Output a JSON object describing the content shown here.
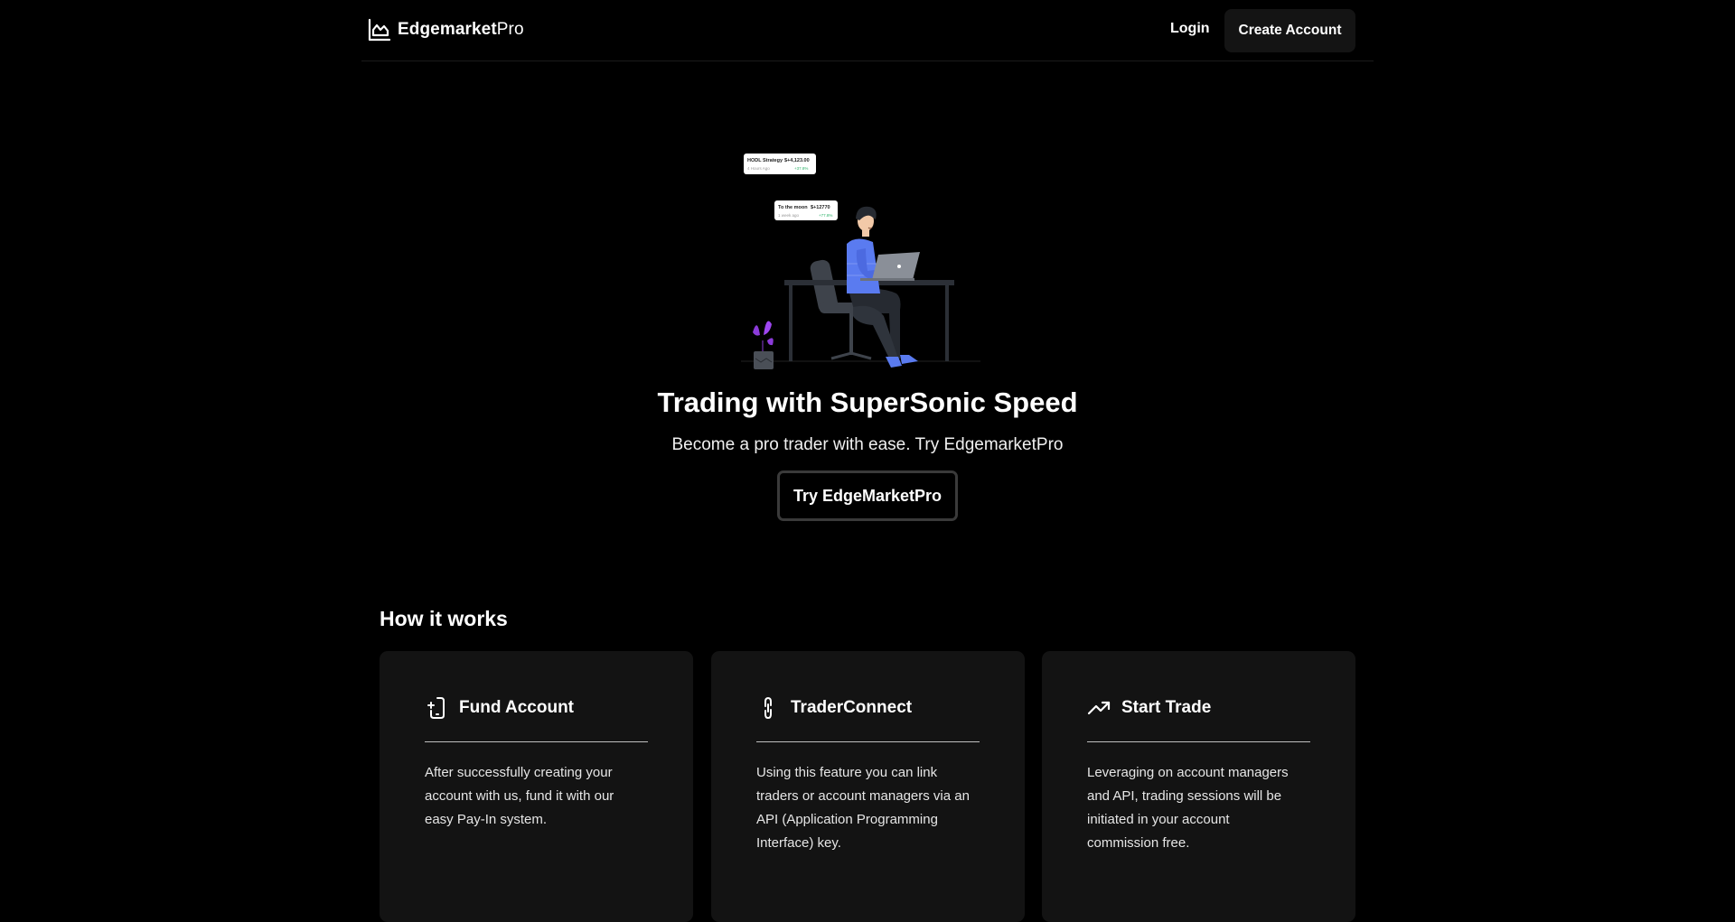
{
  "header": {
    "brand": {
      "name_bold": "Edgemarket",
      "name_light": "Pro",
      "icon": "chart-area-icon"
    },
    "login_label": "Login",
    "create_account_label": "Create Account"
  },
  "hero": {
    "title": "Trading with SuperSonic Speed",
    "subtitle": "Become a pro trader with ease. Try EdgemarketPro",
    "cta_label": "Try EdgeMarketPro",
    "illustration": {
      "card1": {
        "name": "HODL Strategy",
        "amount": "$+4,123.00",
        "meta": "4 Hours Ago",
        "change": "+37.8%"
      },
      "card2": {
        "name": "To the moon",
        "amount": "$+12770",
        "meta": "1 week ago",
        "change": "+77.8%"
      }
    }
  },
  "how_it_works": {
    "title": "How it works",
    "cards": [
      {
        "icon": "phone-plus-icon",
        "title": "Fund Account",
        "description": "After successfully creating your account with us, fund it with our easy Pay-In system."
      },
      {
        "icon": "link-icon",
        "title": "TraderConnect",
        "description": "Using this feature you can link traders or  account managers via an API (Application Programming Interface)  key."
      },
      {
        "icon": "trending-up-icon",
        "title": "Start Trade",
        "description": "Leveraging on account managers and API, trading sessions will be initiated in your account commission free."
      }
    ]
  },
  "colors": {
    "background": "#000000",
    "card_background": "#131313",
    "button_background": "#141414",
    "accent_purple": "#8b3bd9",
    "illustration_blue": "#5a7bf0"
  }
}
